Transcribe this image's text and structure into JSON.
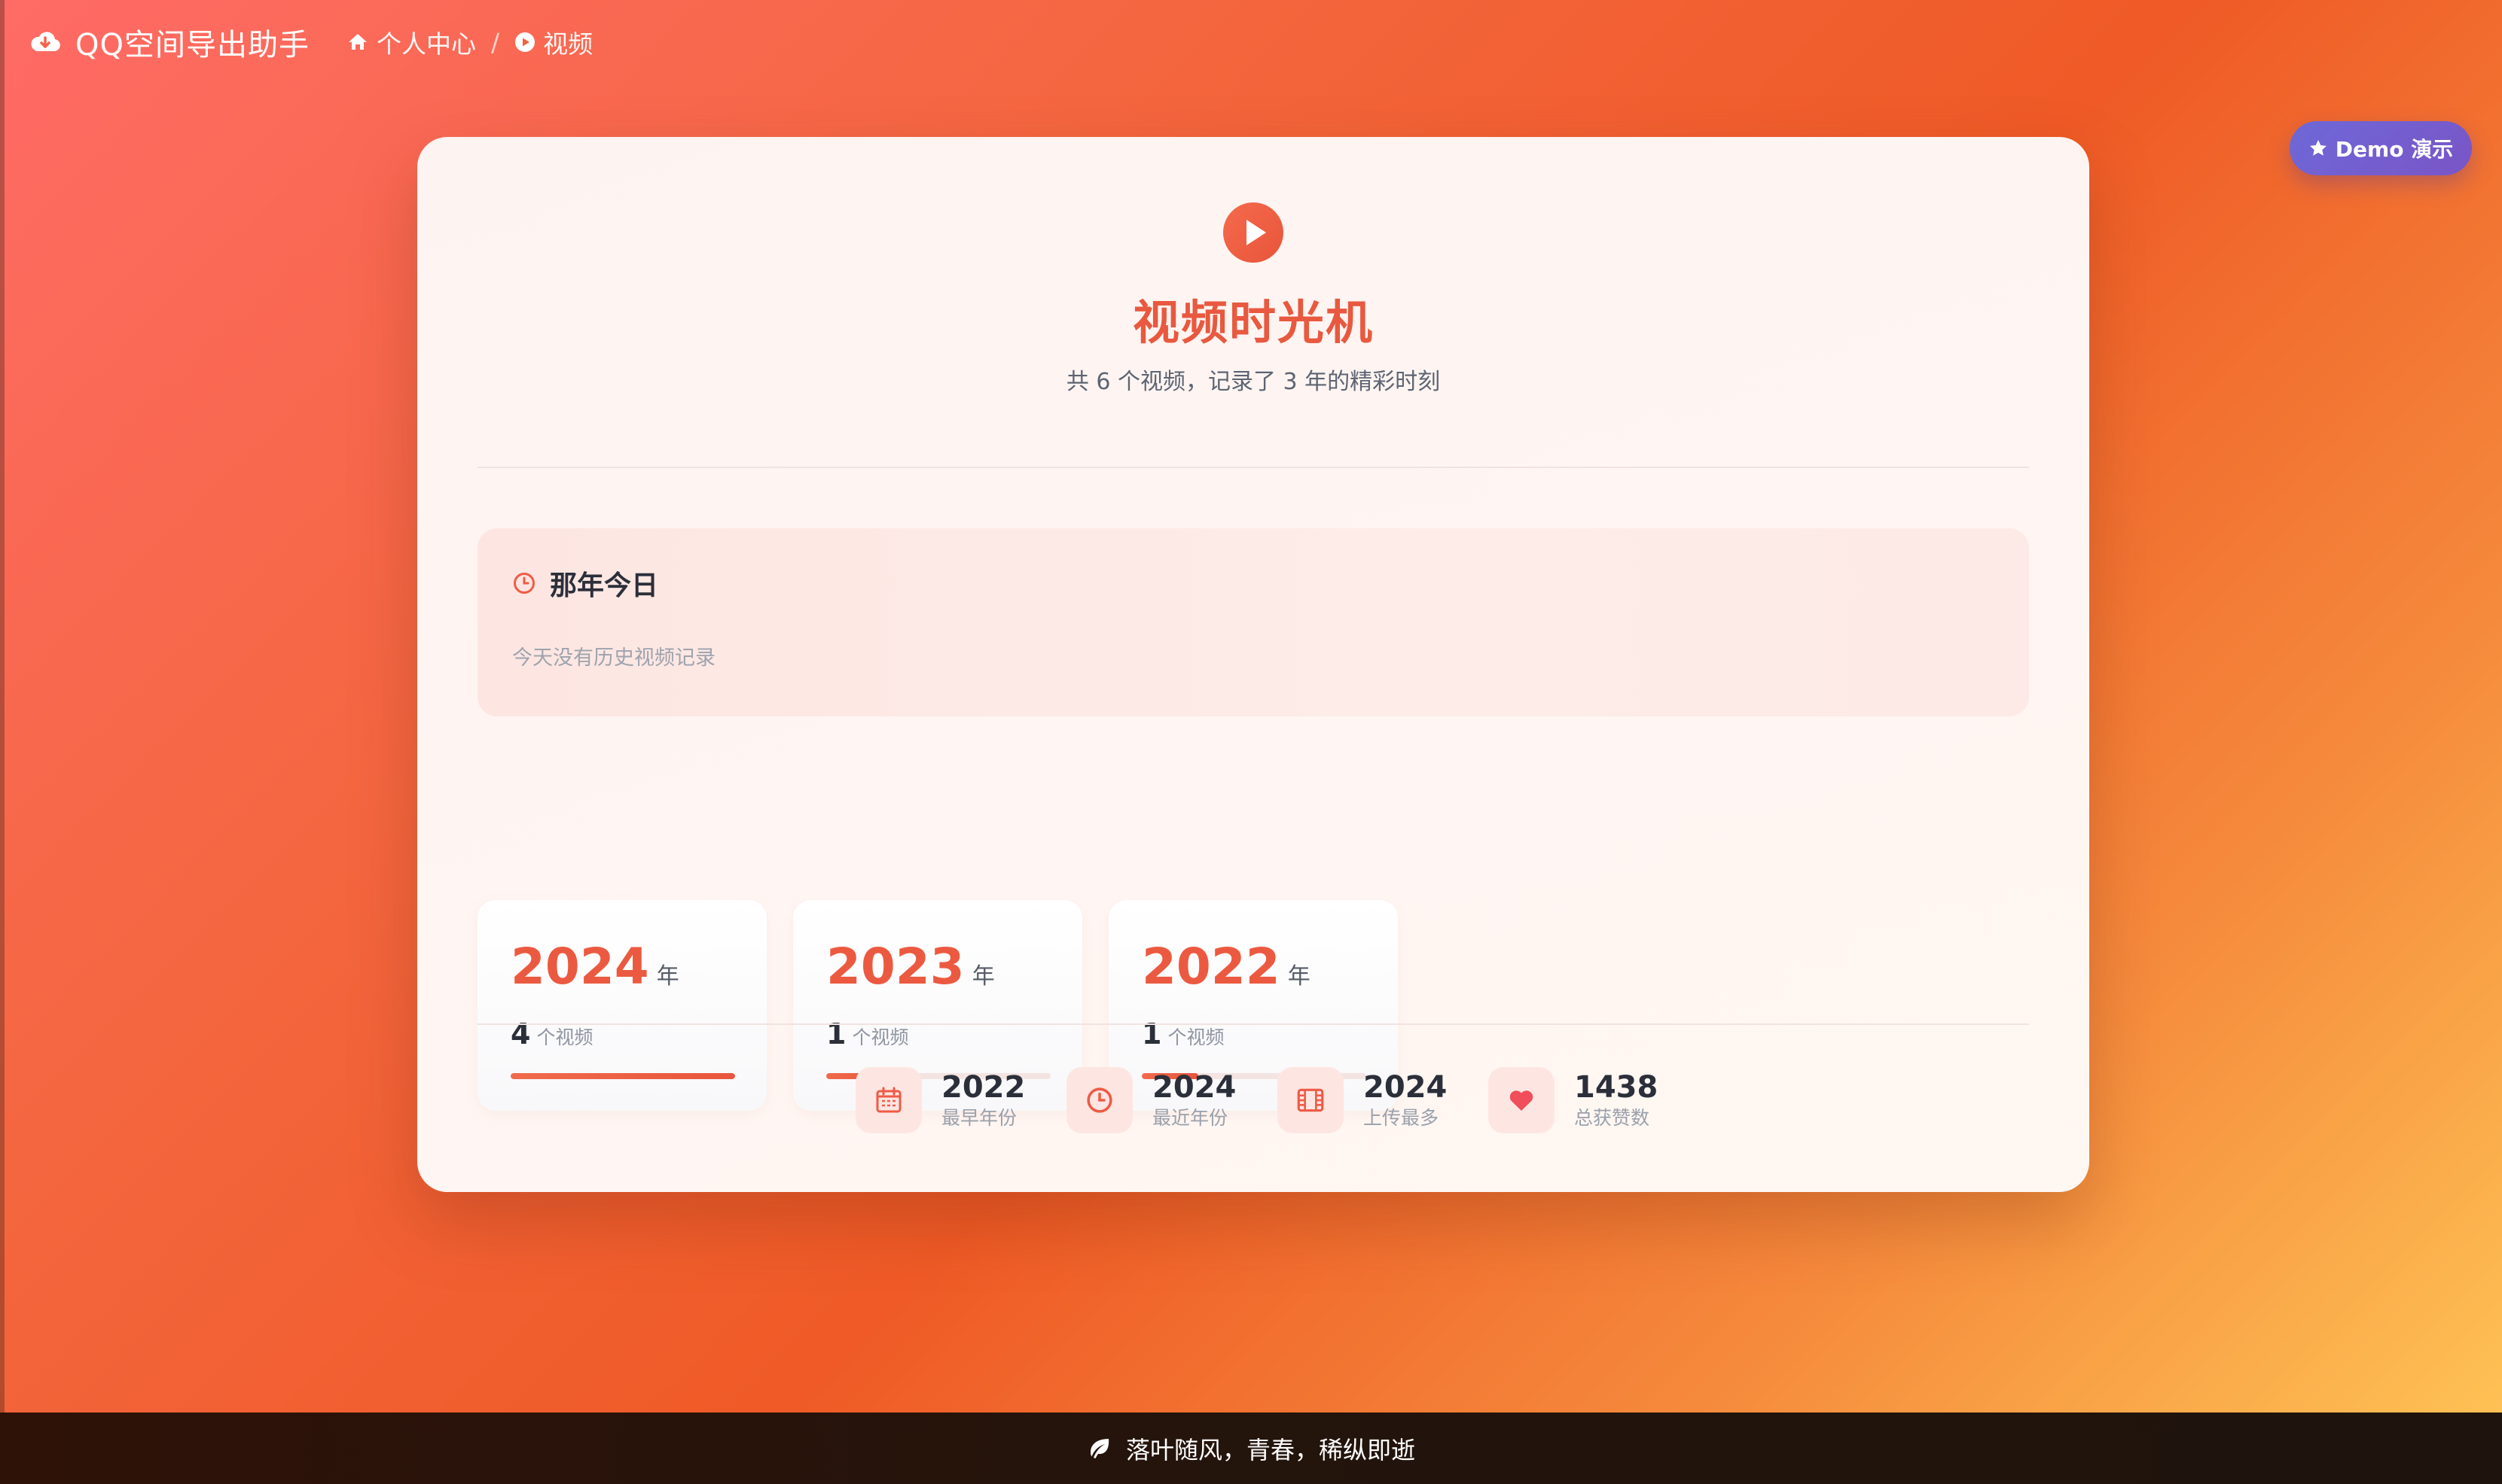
{
  "nav": {
    "brand": "QQ空间导出助手",
    "breadcrumb": [
      {
        "label": "个人中心",
        "icon": "home-icon"
      },
      {
        "label": "视频",
        "icon": "play-circle-icon"
      }
    ],
    "separator": "/"
  },
  "demo_button": {
    "label": "Demo 演示",
    "icon": "star-icon"
  },
  "hero": {
    "icon": "play-circle-icon",
    "title": "视频时光机",
    "subtitle": "共 6 个视频，记录了 3 年的精彩时刻"
  },
  "on_this_day": {
    "icon": "clock-icon",
    "title": "那年今日",
    "empty_text": "今天没有历史视频记录"
  },
  "years": [
    {
      "year": "2024",
      "unit": "年",
      "count": "4",
      "count_unit": "个视频",
      "progress": 1.0
    },
    {
      "year": "2023",
      "unit": "年",
      "count": "1",
      "count_unit": "个视频",
      "progress": 0.25
    },
    {
      "year": "2022",
      "unit": "年",
      "count": "1",
      "count_unit": "个视频",
      "progress": 0.25
    }
  ],
  "stats": [
    {
      "value": "2022",
      "label": "最早年份",
      "icon": "calendar-icon"
    },
    {
      "value": "2024",
      "label": "最近年份",
      "icon": "clock-icon"
    },
    {
      "value": "2024",
      "label": "上传最多",
      "icon": "film-icon"
    },
    {
      "value": "1438",
      "label": "总获赞数",
      "icon": "heart-icon"
    }
  ],
  "footer": {
    "icon": "leaf-icon",
    "text": "落叶随风，青春，稀纵即逝"
  },
  "colors": {
    "accent": "#eb5a40",
    "demo_button": "#6e68d8",
    "text_dark": "#2b2f3a",
    "muted": "#9aa0ab"
  }
}
